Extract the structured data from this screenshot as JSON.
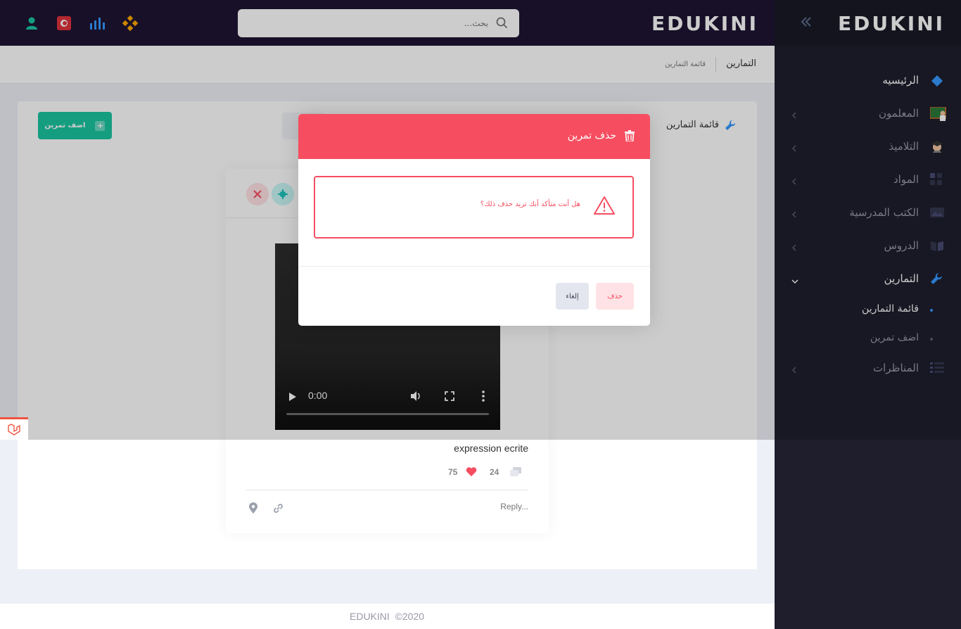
{
  "app": {
    "brand": "EDUKINI"
  },
  "header": {
    "search_placeholder": "بحث...",
    "icons": [
      "user-icon",
      "tunisia-flag-icon",
      "chart-bars-icon",
      "apps-icon"
    ]
  },
  "breadcrumb": {
    "title": "التمارين",
    "item": "قائمة التمارين"
  },
  "card": {
    "title": "قائمة التمارين",
    "add_button": "اضف تمرين"
  },
  "post": {
    "video_time": "0:00",
    "title": "expression ecrite",
    "likes": "75",
    "comments": "24",
    "reply_placeholder": "Reply..."
  },
  "footer": {
    "year": "©2020",
    "brand": "EDUKINI"
  },
  "sidebar": {
    "items": [
      {
        "label": "الرئيسيه",
        "icon": "layers-icon"
      },
      {
        "label": "المعلمون",
        "icon": "teacher-icon"
      },
      {
        "label": "التلاميذ",
        "icon": "student-icon"
      },
      {
        "label": "المواد",
        "icon": "grid-icon"
      },
      {
        "label": "الكتب المدرسية",
        "icon": "image-icon"
      },
      {
        "label": "الدروس",
        "icon": "book-icon"
      },
      {
        "label": "التمارين",
        "icon": "wrench-icon"
      },
      {
        "label": "المناظرات",
        "icon": "list-icon"
      }
    ],
    "sub_items": [
      {
        "label": "قائمة التمارين"
      },
      {
        "label": "اضف تمرين"
      }
    ]
  },
  "modal": {
    "title": "حذف تمرين",
    "message": "هل أنت متأكد أنك تريد حذف ذلك؟",
    "delete_label": "حذف",
    "cancel_label": "إلغاء"
  },
  "colors": {
    "header": "#1e1433",
    "sidebar": "#1e1e2d",
    "danger": "#f64e60",
    "success": "#1bc5a0",
    "primary": "#3699ff"
  }
}
